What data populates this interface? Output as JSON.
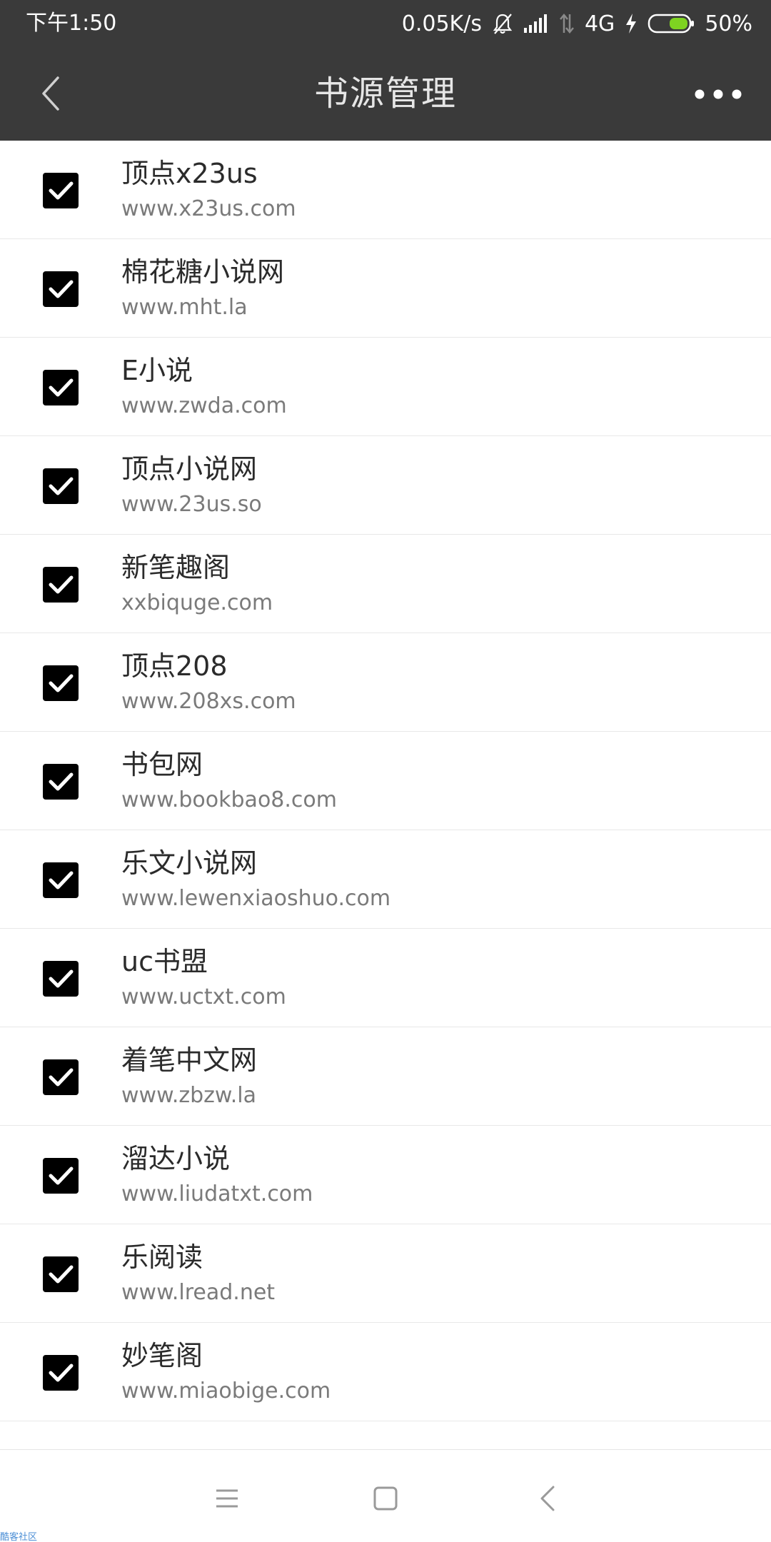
{
  "status_bar": {
    "time": "下午1:50",
    "speed": "0.05K/s",
    "network": "4G",
    "battery": "50%",
    "icons": [
      "bell-off-icon",
      "signal-icon",
      "data-arrows-icon",
      "charging-icon",
      "battery-icon"
    ]
  },
  "toolbar": {
    "title": "书源管理",
    "back_icon": "chevron-left-icon",
    "more_icon": "more-horizontal-icon"
  },
  "sources": [
    {
      "name": "顶点x23us",
      "url": "www.x23us.com",
      "checked": true
    },
    {
      "name": "棉花糖小说网",
      "url": "www.mht.la",
      "checked": true
    },
    {
      "name": "E小说",
      "url": "www.zwda.com",
      "checked": true
    },
    {
      "name": "顶点小说网",
      "url": "www.23us.so",
      "checked": true
    },
    {
      "name": "新笔趣阁",
      "url": "xxbiquge.com",
      "checked": true
    },
    {
      "name": "顶点208",
      "url": "www.208xs.com",
      "checked": true
    },
    {
      "name": "书包网",
      "url": "www.bookbao8.com",
      "checked": true
    },
    {
      "name": "乐文小说网",
      "url": "www.lewenxiaoshuo.com",
      "checked": true
    },
    {
      "name": "uc书盟",
      "url": "www.uctxt.com",
      "checked": true
    },
    {
      "name": "着笔中文网",
      "url": "www.zbzw.la",
      "checked": true
    },
    {
      "name": "溜达小说",
      "url": "www.liudatxt.com",
      "checked": true
    },
    {
      "name": "乐阅读",
      "url": "www.lread.net",
      "checked": true
    },
    {
      "name": "妙笔阁",
      "url": "www.miaobige.com",
      "checked": true
    }
  ],
  "nav_bar": {
    "icons": [
      "menu-icon",
      "home-icon",
      "back-icon"
    ]
  },
  "watermark": "酷客社区",
  "colors": {
    "toolbar_bg": "#3a3a3a",
    "checkbox": "#000000",
    "name_text": "#2b2b2b",
    "url_text": "#7a7a7a"
  }
}
